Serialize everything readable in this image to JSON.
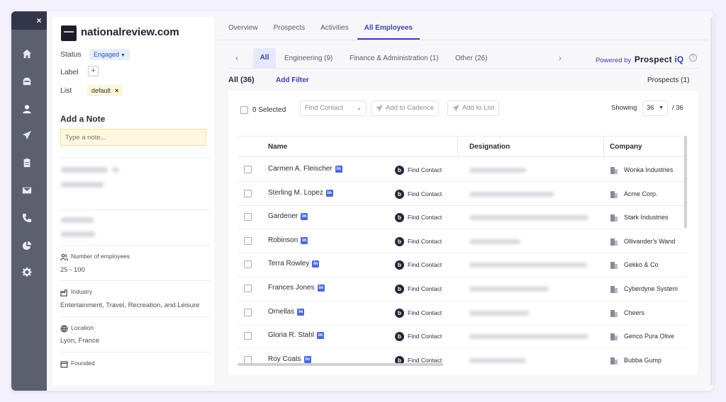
{
  "rail": {
    "close_glyph": "×",
    "icons": [
      "home-icon",
      "inbox-icon",
      "user-icon",
      "send-icon",
      "clipboard-icon",
      "mail-icon",
      "phone-icon",
      "pie-chart-icon",
      "settings-icon"
    ]
  },
  "company": {
    "name": "nationalreview.com",
    "status_label": "Status",
    "status_value": "Engaged",
    "label_label": "Label",
    "add_label_glyph": "+",
    "list_label": "List",
    "list_tag": "default",
    "list_tag_remove": "×",
    "note_heading": "Add a Note",
    "note_placeholder": "Type a note...",
    "employees_label": "Number of employees",
    "employees_value": "25 - 100",
    "industry_label": "Industry",
    "industry_value": "Entertainment, Travel, Recreation, and Leisure",
    "location_label": "Location",
    "location_value": "Lyon, France",
    "founded_label": "Founded"
  },
  "tabs": [
    "Overview",
    "Prospects",
    "Activities",
    "All Employees"
  ],
  "active_tab": "All Employees",
  "filters": {
    "prev": "‹",
    "next": "›",
    "all": "All",
    "engineering": "Engineering (9)",
    "finance": "Finance & Administration (1)",
    "other": "Other (26)",
    "powered_by": "Powered by",
    "brand_main": "Prospect ",
    "brand_accent": "iQ",
    "help": "?"
  },
  "summary": {
    "all_count": "All  (36)",
    "add_filter": "Add Filter",
    "prospects": "Prospects (1)"
  },
  "toolbar": {
    "selected": "0 Selected",
    "find_contact": "Find Contact",
    "add_to_cadence": "Add to Cadence",
    "add_to_list": "Add to List",
    "showing": "Showing",
    "page_size": "36",
    "total": "/ 36"
  },
  "table": {
    "headers": {
      "name": "Name",
      "designation": "Designation",
      "company": "Company"
    },
    "linkedin_glyph": "in",
    "find_contact_glyph": "b",
    "rows": [
      {
        "name": "Carmen A. Fleischer",
        "action": "Find Contact",
        "company": "Wonka Industries"
      },
      {
        "name": "Sterling M. Lopez",
        "action": "Find Contact",
        "company": "Acme Corp."
      },
      {
        "name": "Gardener",
        "action": "Find Contact",
        "company": "Stark Industries"
      },
      {
        "name": "Robinson",
        "action": "Find Contact",
        "company": "Ollivander's Wand"
      },
      {
        "name": "Terra Rowley",
        "action": "Find Contact",
        "company": "Gekko & Co"
      },
      {
        "name": "Frances Jones",
        "action": "Find Contact",
        "company": "Cyberdyne System"
      },
      {
        "name": "Ornellas",
        "action": "Find Contact",
        "company": "Cheers"
      },
      {
        "name": "Gloria R. Stahl",
        "action": "Find Contact",
        "company": "Genco Pura Olive"
      },
      {
        "name": "Roy Coats",
        "action": "Find Contact",
        "company": "Bubba Gump"
      }
    ]
  },
  "colors": {
    "accent": "#3c3eab",
    "rail": "#5b5f6e",
    "note_bg": "#fdf8dd",
    "linkedin": "#4a6ad8"
  }
}
